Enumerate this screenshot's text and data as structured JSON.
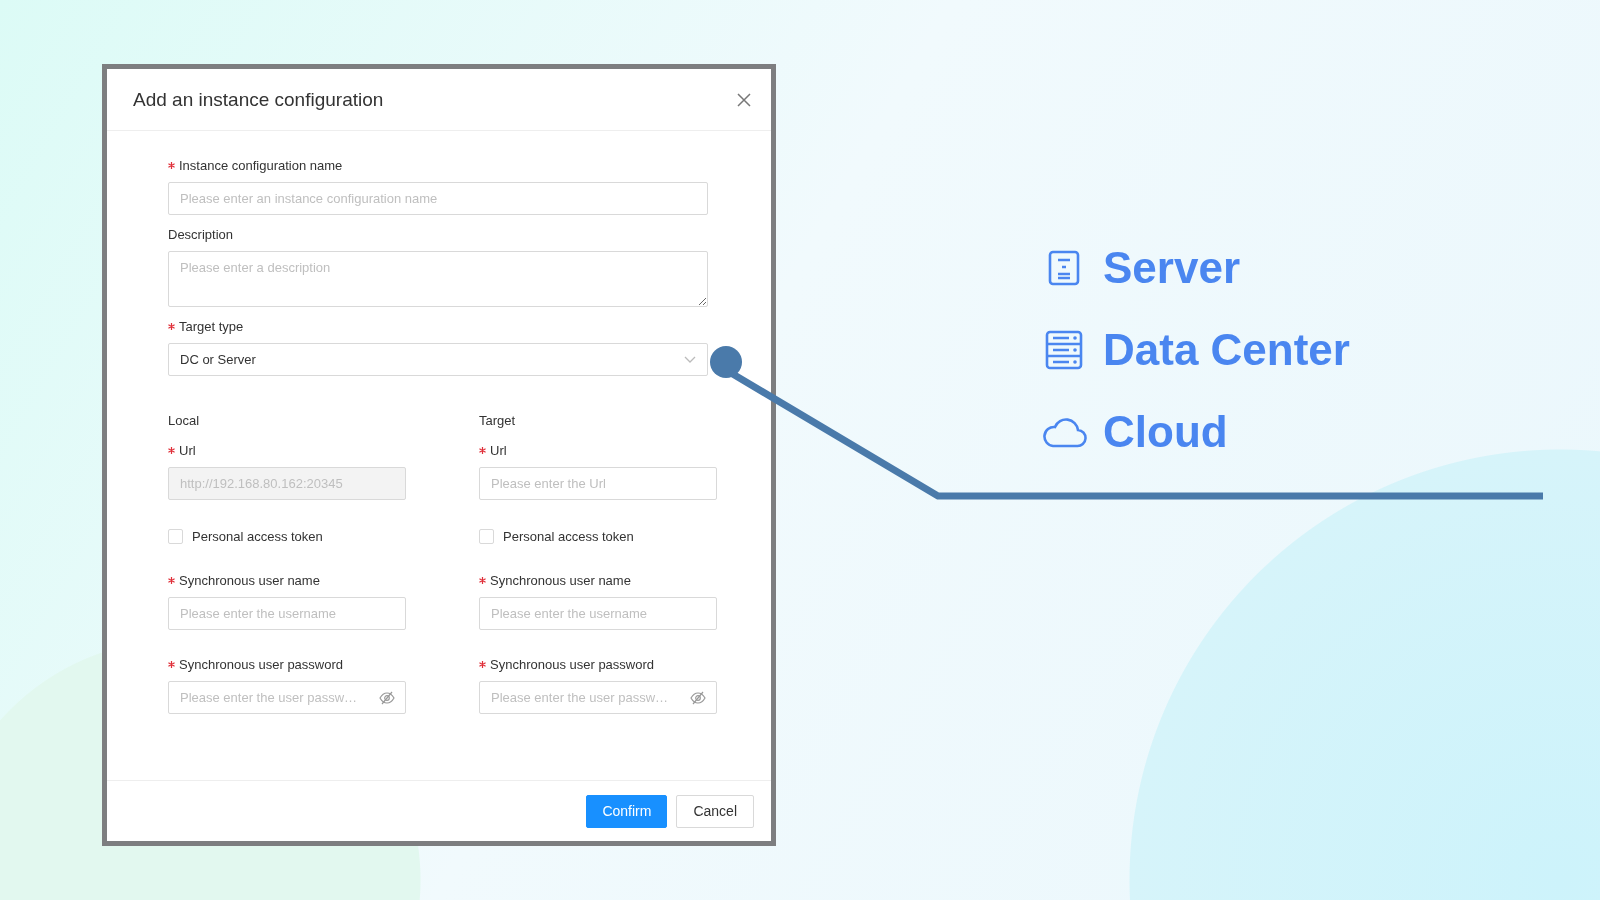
{
  "dialog": {
    "title": "Add an instance configuration",
    "fields": [
      {
        "kind": "input",
        "label": "Instance configuration name",
        "required": true,
        "placeholder": "Please enter an instance configuration name"
      },
      {
        "kind": "textarea",
        "label": "Description",
        "required": false,
        "placeholder": "Please enter a description"
      },
      {
        "kind": "select",
        "label": "Target type",
        "required": true,
        "value": "DC or Server"
      }
    ],
    "columns": [
      {
        "heading": "Local",
        "url": {
          "label": "Url",
          "required": true,
          "value": "http://192.168.80.162:20345",
          "disabled": true
        },
        "token": {
          "label": "Personal access token",
          "checked": false
        },
        "username": {
          "label": "Synchronous user name",
          "required": true,
          "placeholder": "Please enter the username"
        },
        "password": {
          "label": "Synchronous user password",
          "required": true,
          "placeholder": "Please enter the user passw…"
        }
      },
      {
        "heading": "Target",
        "url": {
          "label": "Url",
          "required": true,
          "placeholder": "Please enter the Url",
          "disabled": false
        },
        "token": {
          "label": "Personal access token",
          "checked": false
        },
        "username": {
          "label": "Synchronous user name",
          "required": true,
          "placeholder": "Please enter the username"
        },
        "password": {
          "label": "Synchronous user password",
          "required": true,
          "placeholder": "Please enter the user passw…"
        }
      }
    ],
    "buttons": [
      {
        "label": "Confirm",
        "primary": true
      },
      {
        "label": "Cancel",
        "primary": false
      }
    ]
  },
  "target_types": [
    {
      "kind": "server",
      "label": "Server"
    },
    {
      "kind": "datacenter",
      "label": "Data Center"
    },
    {
      "kind": "cloud",
      "label": "Cloud"
    }
  ]
}
